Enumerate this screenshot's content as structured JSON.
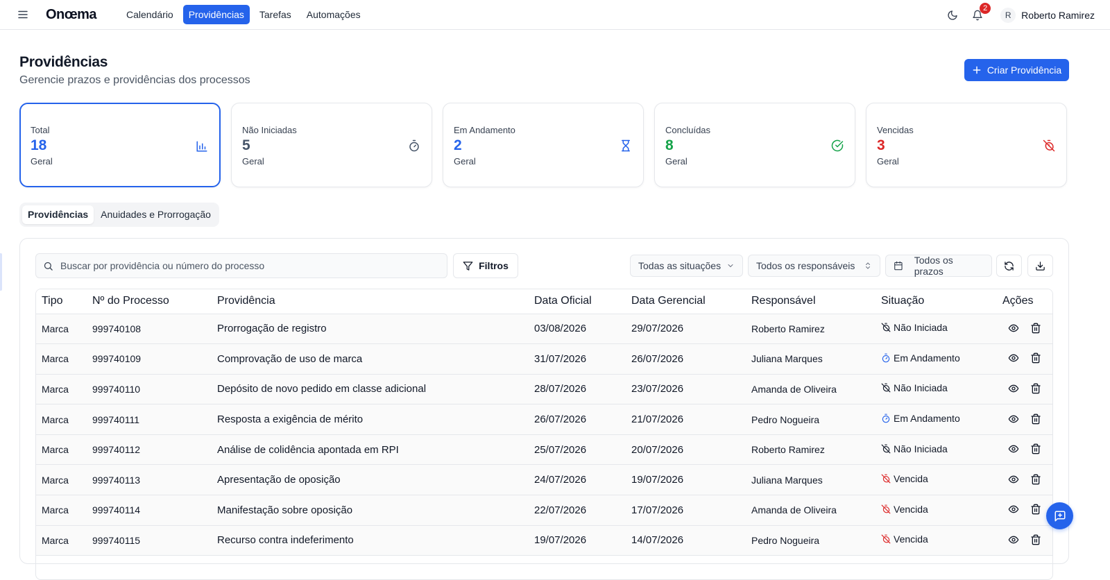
{
  "nav": {
    "logo": "Onœma",
    "links": [
      "Calendário",
      "Providências",
      "Tarefas",
      "Automações"
    ],
    "active_index": 1,
    "notification_count": "2",
    "user_initial": "R",
    "user_name": "Roberto Ramirez"
  },
  "header": {
    "title": "Providências",
    "subtitle": "Gerencie prazos e providências dos processos",
    "create_label": "Criar Providência"
  },
  "stats": [
    {
      "label": "Total",
      "value": "18",
      "sub": "Geral",
      "color": "#2563eb",
      "icon": "bar-chart-icon"
    },
    {
      "label": "Não Iniciadas",
      "value": "5",
      "sub": "Geral",
      "color": "#475569",
      "icon": "timer-icon"
    },
    {
      "label": "Em Andamento",
      "value": "2",
      "sub": "Geral",
      "color": "#2563eb",
      "icon": "hourglass-icon"
    },
    {
      "label": "Concluídas",
      "value": "8",
      "sub": "Geral",
      "color": "#16a34a",
      "icon": "check-circle-icon"
    },
    {
      "label": "Vencidas",
      "value": "3",
      "sub": "Geral",
      "color": "#dc2626",
      "icon": "timer-off-icon"
    }
  ],
  "tabs": [
    "Providências",
    "Anuidades e Prorrogação"
  ],
  "toolbar": {
    "search_placeholder": "Buscar por providência ou número do processo",
    "filters_label": "Filtros",
    "situation_select": "Todas as situações",
    "responsible_select": "Todos os responsáveis",
    "deadline_select": "Todos os prazos"
  },
  "table": {
    "columns": [
      "Tipo",
      "Nº do Processo",
      "Providência",
      "Data Oficial",
      "Data Gerencial",
      "Responsável",
      "Situação",
      "Ações"
    ],
    "rows": [
      {
        "tipo": "Marca",
        "processo": "999740108",
        "providencia": "Prorrogação de registro",
        "oficial": "03/08/2026",
        "gerencial": "29/07/2026",
        "responsavel": "Roberto Ramirez",
        "situacao": "Não Iniciada",
        "status": "nao-iniciada"
      },
      {
        "tipo": "Marca",
        "processo": "999740109",
        "providencia": "Comprovação de uso de marca",
        "oficial": "31/07/2026",
        "gerencial": "26/07/2026",
        "responsavel": "Juliana Marques",
        "situacao": "Em Andamento",
        "status": "em-andamento"
      },
      {
        "tipo": "Marca",
        "processo": "999740110",
        "providencia": "Depósito de novo pedido em classe adicional",
        "oficial": "28/07/2026",
        "gerencial": "23/07/2026",
        "responsavel": "Amanda de Oliveira",
        "situacao": "Não Iniciada",
        "status": "nao-iniciada"
      },
      {
        "tipo": "Marca",
        "processo": "999740111",
        "providencia": "Resposta a exigência de mérito",
        "oficial": "26/07/2026",
        "gerencial": "21/07/2026",
        "responsavel": "Pedro Nogueira",
        "situacao": "Em Andamento",
        "status": "em-andamento"
      },
      {
        "tipo": "Marca",
        "processo": "999740112",
        "providencia": "Análise de colidência apontada em RPI",
        "oficial": "25/07/2026",
        "gerencial": "20/07/2026",
        "responsavel": "Roberto Ramirez",
        "situacao": "Não Iniciada",
        "status": "nao-iniciada"
      },
      {
        "tipo": "Marca",
        "processo": "999740113",
        "providencia": "Apresentação de oposição",
        "oficial": "24/07/2026",
        "gerencial": "19/07/2026",
        "responsavel": "Juliana Marques",
        "situacao": "Vencida",
        "status": "vencida"
      },
      {
        "tipo": "Marca",
        "processo": "999740114",
        "providencia": "Manifestação sobre oposição",
        "oficial": "22/07/2026",
        "gerencial": "17/07/2026",
        "responsavel": "Amanda de Oliveira",
        "situacao": "Vencida",
        "status": "vencida"
      },
      {
        "tipo": "Marca",
        "processo": "999740115",
        "providencia": "Recurso contra indeferimento",
        "oficial": "19/07/2026",
        "gerencial": "14/07/2026",
        "responsavel": "Pedro Nogueira",
        "situacao": "Vencida",
        "status": "vencida"
      }
    ]
  },
  "colors": {
    "accent": "#2563eb",
    "danger": "#dc2626",
    "success": "#16a34a",
    "muted": "#475569"
  }
}
